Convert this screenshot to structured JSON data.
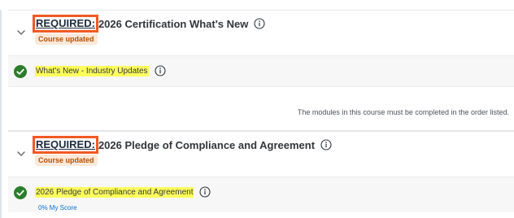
{
  "courses": [
    {
      "required_label": "REQUIRED:",
      "title": "2026 Certification What's New",
      "badge": "Course updated",
      "module": {
        "title": "What's New - Industry Updates",
        "status": "completed"
      },
      "order_note": "The modules in this course must be completed in the order listed."
    },
    {
      "required_label": "REQUIRED:",
      "title": "2026 Pledge of Compliance and Agreement",
      "badge": "Course updated",
      "module": {
        "title": "2026 Pledge of Compliance and Agreement",
        "status": "completed",
        "score": "0% My Score"
      }
    }
  ],
  "colors": {
    "required_outline": "#f15a24",
    "highlight": "#ffff5c",
    "badge_bg": "#fde9d9",
    "badge_text": "#b64f00",
    "check_green": "#2b7d2b",
    "score_link": "#0a6ed1"
  },
  "icons": {
    "expand": "chevron-down-icon",
    "info": "info-icon",
    "complete": "check-circle-icon"
  }
}
